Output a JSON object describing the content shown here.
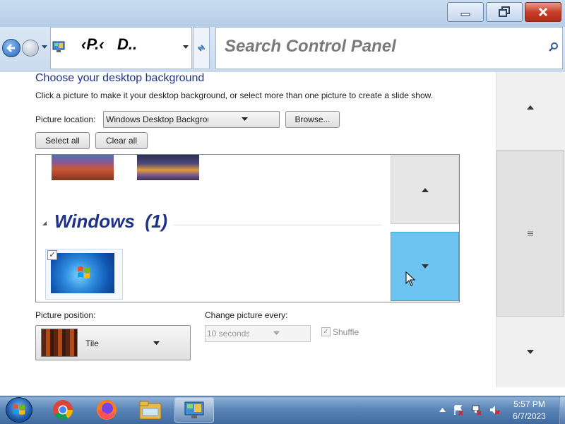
{
  "window": {
    "address": "‹P.‹   D..",
    "search_placeholder": "Search Control Panel"
  },
  "content": {
    "title": "Choose your desktop background",
    "description": "Click a picture to make it your desktop background, or select more than one picture to create a slide show.",
    "picture_location_label": "Picture location:",
    "picture_location_value": "Windows Desktop Backgrounds",
    "browse_label": "Browse...",
    "select_all_label": "Select all",
    "clear_all_label": "Clear all",
    "gallery": {
      "group_header": "Windows  (1)",
      "windows_selected": true
    },
    "picture_position_label": "Picture position:",
    "picture_position_value": "Tile",
    "change_every_label": "Change picture every:",
    "change_every_value": "10 seconds",
    "shuffle_label": "Shuffle"
  },
  "taskbar": {
    "time": "5:57 PM",
    "date": "6/7/2023"
  },
  "colors": {
    "title_text": "#1e3287",
    "hover_blue": "#6ec4f0",
    "close_red": "#c8402b"
  },
  "icons": {
    "minimize": "minimize-icon",
    "maximize": "restore-icon",
    "close": "close-icon",
    "search": "search-icon",
    "refresh": "refresh-icon",
    "scroll_up": "chevron-up-icon",
    "scroll_down": "chevron-down-icon"
  }
}
